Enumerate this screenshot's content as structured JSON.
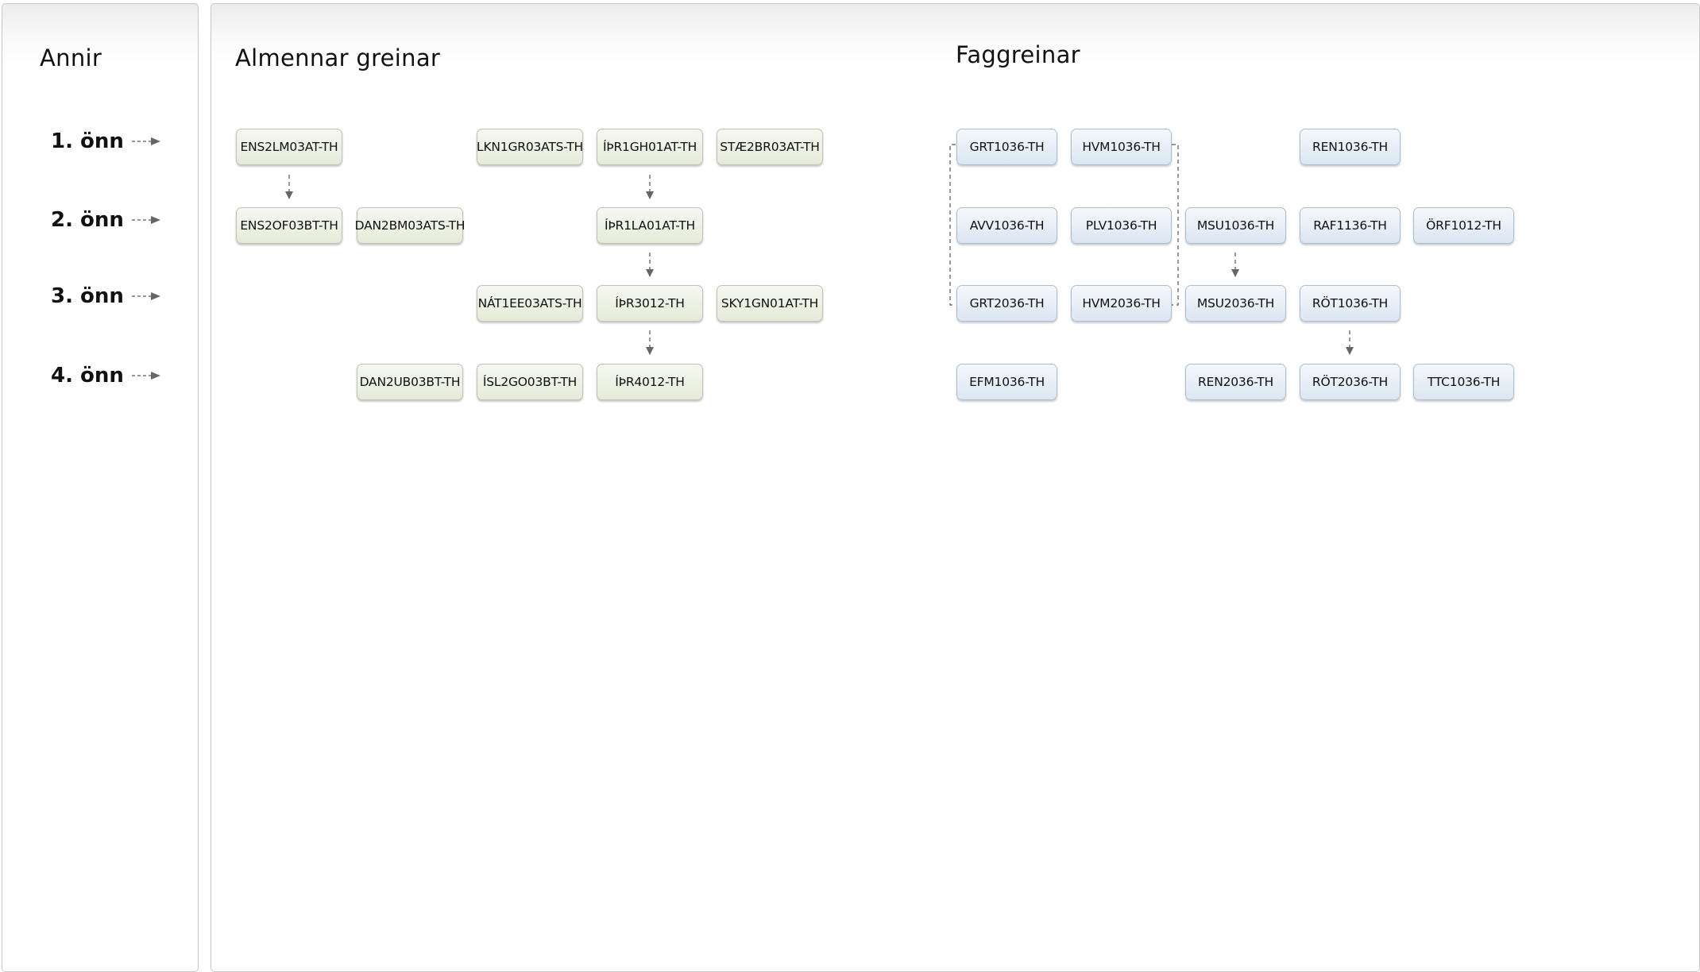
{
  "left_panel": {
    "title": "Annir",
    "semesters": [
      "1. önn",
      "2. önn",
      "3. önn",
      "4. önn"
    ]
  },
  "general": {
    "title": "Almennar greinar",
    "courses": {
      "ens2lm": "ENS2LM03AT-TH",
      "lkn1gr": "LKN1GR03ATS-TH",
      "ipr1gh": "ÍÞR1GH01AT-TH",
      "stae2br": "STÆ2BR03AT-TH",
      "ens2of": "ENS2OF03BT-TH",
      "dan2bm": "DAN2BM03ATS-TH",
      "ipr1la": "ÍÞR1LA01AT-TH",
      "nat1ee": "NÁT1EE03ATS-TH",
      "ipr3012": "ÍÞR3012-TH",
      "sky1gn": "SKY1GN01AT-TH",
      "dan2ub": "DAN2UB03BT-TH",
      "isl2go": "ÍSL2GO03BT-TH",
      "ipr4012": "ÍÞR4012-TH"
    }
  },
  "specialized": {
    "title": "Faggreinar",
    "courses": {
      "grt1036": "GRT1036-TH",
      "hvm1036": "HVM1036-TH",
      "ren1036": "REN1036-TH",
      "avv1036": "AVV1036-TH",
      "plv1036": "PLV1036-TH",
      "msu1036": "MSU1036-TH",
      "raf1136": "RAF1136-TH",
      "orf1012": "ÖRF1012-TH",
      "grt2036": "GRT2036-TH",
      "hvm2036": "HVM2036-TH",
      "msu2036": "MSU2036-TH",
      "rot1036": "RÖT1036-TH",
      "efm1036": "EFM1036-TH",
      "ren2036": "REN2036-TH",
      "rot2036": "RÖT2036-TH",
      "ttc1036": "TTC1036-TH"
    }
  },
  "colors": {
    "general_box": "#e5ebd9",
    "specialized_box": "#dbe6f1",
    "connector": "#777777"
  }
}
